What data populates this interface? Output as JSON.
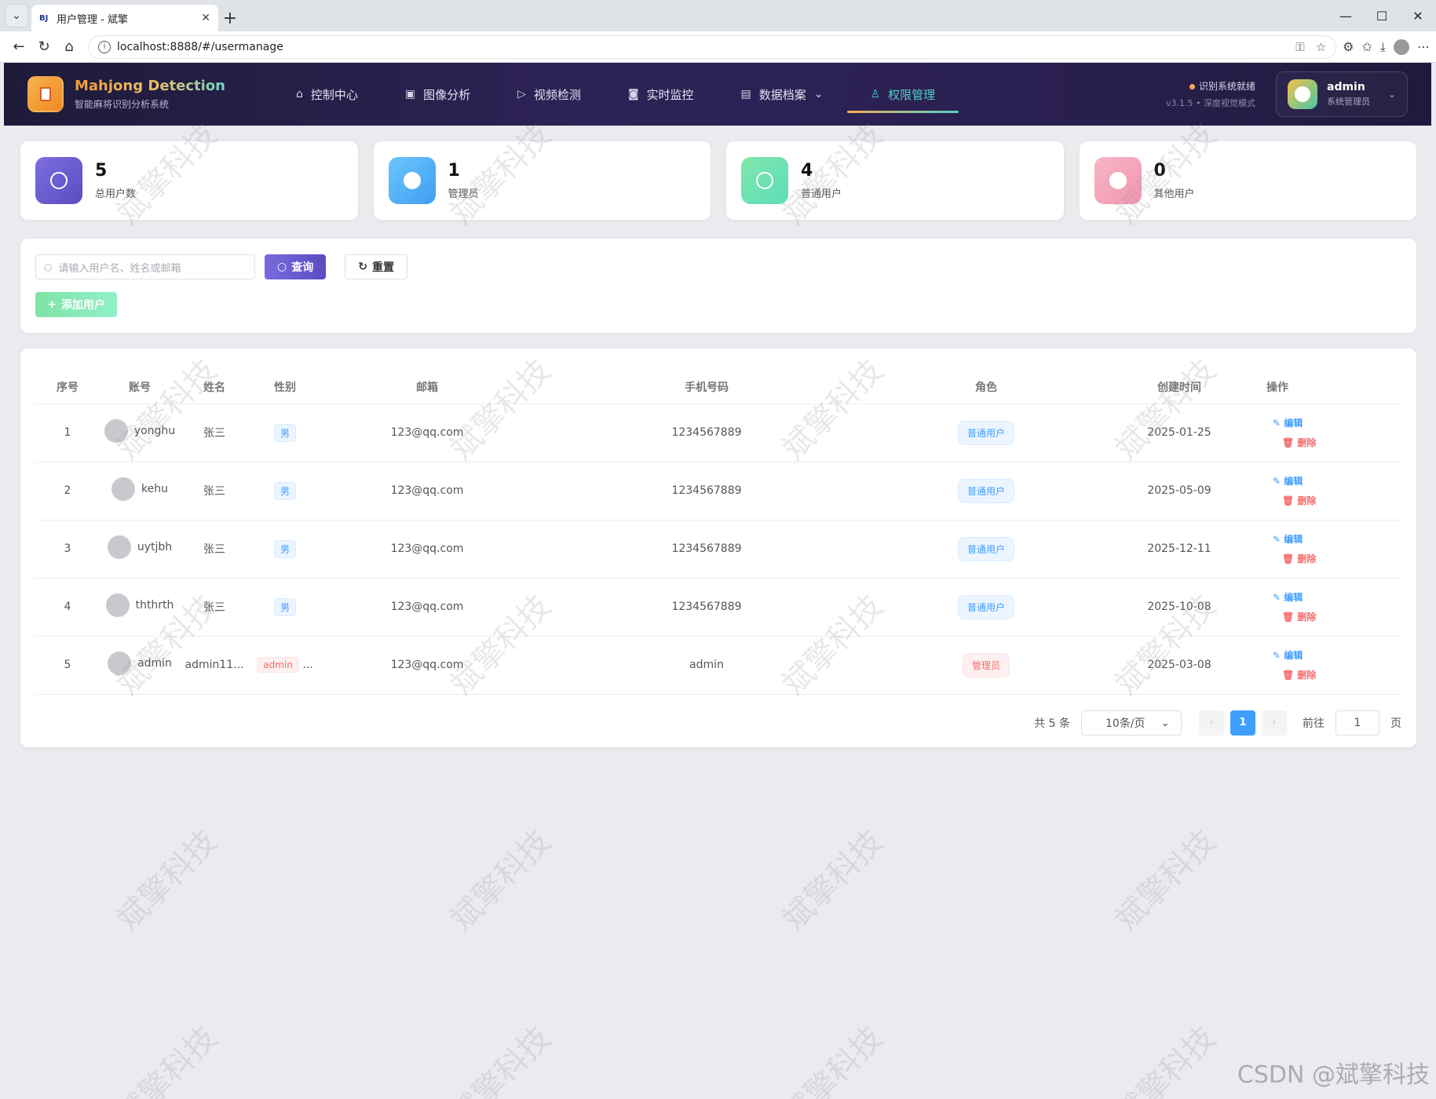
{
  "browser": {
    "tab_title": "用户管理 - 斌擎",
    "tab_favicon": "BJ",
    "url": "localhost:8888/#/usermanage"
  },
  "header": {
    "brand_prefix": "Mahjong",
    "brand_suffix": "Detection",
    "brand_sub": "智能麻将识别分析系统",
    "nav": [
      {
        "label": "控制中心",
        "icon": "home-icon"
      },
      {
        "label": "图像分析",
        "icon": "image-icon"
      },
      {
        "label": "视频检测",
        "icon": "play-icon"
      },
      {
        "label": "实时监控",
        "icon": "camera-icon"
      },
      {
        "label": "数据档案",
        "icon": "document-icon"
      },
      {
        "label": "权限管理",
        "icon": "user-icon"
      }
    ],
    "status_text": "识别系统就绪",
    "version_text": "v3.1.5 • 深度视觉模式",
    "user_name": "admin",
    "user_role": "系统管理员"
  },
  "stats": [
    {
      "value": "5",
      "label": "总用户数",
      "color": "#6b5fd3"
    },
    {
      "value": "1",
      "label": "管理员",
      "color": "#4fb3f6"
    },
    {
      "value": "4",
      "label": "普通用户",
      "color": "#6fe3a3"
    },
    {
      "value": "0",
      "label": "其他用户",
      "color": "#f5a9bd"
    }
  ],
  "search": {
    "placeholder": "请输入用户名、姓名或邮箱",
    "query_label": "查询",
    "reset_label": "重置",
    "add_label": "添加用户"
  },
  "table": {
    "headers": [
      "序号",
      "账号",
      "姓名",
      "性别",
      "邮箱",
      "手机号码",
      "角色",
      "创建时间",
      "操作"
    ],
    "edit_label": "编辑",
    "delete_label": "删除",
    "rows": [
      {
        "idx": "1",
        "account": "yonghu",
        "name": "张三",
        "gender": "男",
        "email": "123@qq.com",
        "phone": "1234567889",
        "role": "普通用户",
        "created": "2025-01-25"
      },
      {
        "idx": "2",
        "account": "kehu",
        "name": "张三",
        "gender": "男",
        "email": "123@qq.com",
        "phone": "1234567889",
        "role": "普通用户",
        "created": "2025-05-09"
      },
      {
        "idx": "3",
        "account": "uytjbh",
        "name": "张三",
        "gender": "男",
        "email": "123@qq.com",
        "phone": "1234567889",
        "role": "普通用户",
        "created": "2025-12-11"
      },
      {
        "idx": "4",
        "account": "ththrth",
        "name": "张三",
        "gender": "男",
        "email": "123@qq.com",
        "phone": "1234567889",
        "role": "普通用户",
        "created": "2025-10-08"
      },
      {
        "idx": "5",
        "account": "admin",
        "name": "admin11...",
        "gender": "admin",
        "gender_suffix": "...",
        "email": "123@qq.com",
        "phone": "admin",
        "role": "管理员",
        "created": "2025-03-08"
      }
    ]
  },
  "pagination": {
    "total": "共 5 条",
    "page_size": "10条/页",
    "current": "1",
    "goto_label": "前往",
    "goto_value": "1",
    "page_suffix": "页"
  },
  "watermark": {
    "text": "斌擎科技",
    "csdn": "CSDN @斌擎科技"
  }
}
